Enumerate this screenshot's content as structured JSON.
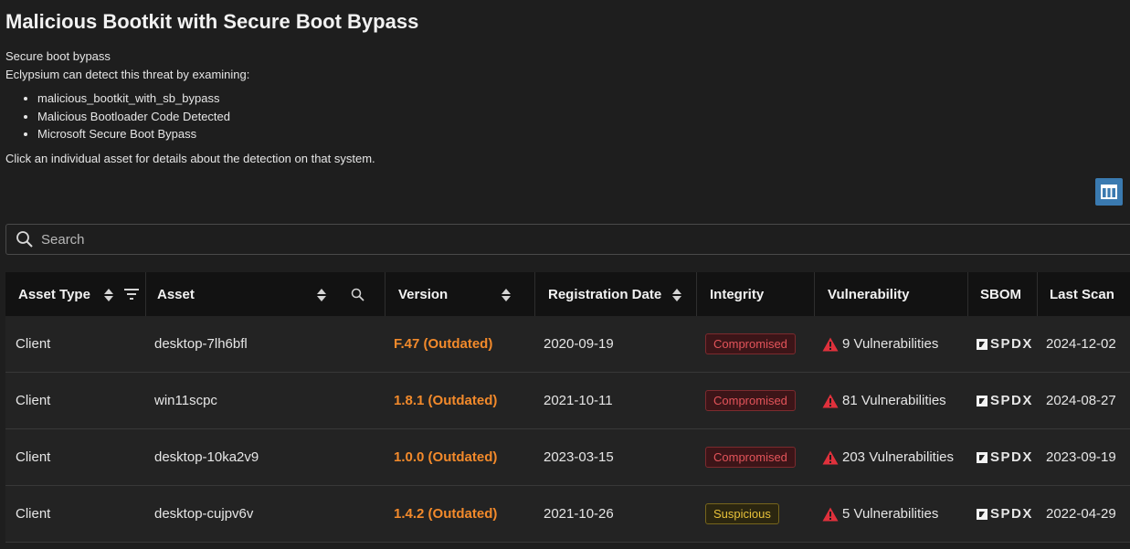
{
  "page": {
    "title": "Malicious Bootkit with Secure Boot Bypass",
    "subtitle": "Secure boot bypass",
    "intro": "Eclypsium can detect this threat by examining:",
    "bullets": [
      "malicious_bootkit_with_sb_bypass",
      "Malicious Bootloader Code Detected",
      "Microsoft Secure Boot Bypass"
    ],
    "hint": "Click an individual asset for details about the detection on that system."
  },
  "search": {
    "placeholder": "Search"
  },
  "table": {
    "columns": {
      "asset_type": "Asset Type",
      "asset": "Asset",
      "version": "Version",
      "registration_date": "Registration Date",
      "integrity": "Integrity",
      "vulnerability": "Vulnerability",
      "sbom": "SBOM",
      "last_scan": "Last Scan"
    },
    "sbom_label": "SPDX",
    "rows": [
      {
        "asset_type": "Client",
        "asset": "desktop-7lh6bfl",
        "version": "F.47 (Outdated)",
        "registration_date": "2020-09-19",
        "integrity": "Compromised",
        "vulnerability": "9 Vulnerabilities",
        "last_scan": "2024-12-02"
      },
      {
        "asset_type": "Client",
        "asset": "win11scpc",
        "version": "1.8.1 (Outdated)",
        "registration_date": "2021-10-11",
        "integrity": "Compromised",
        "vulnerability": "81 Vulnerabilities",
        "last_scan": "2024-08-27"
      },
      {
        "asset_type": "Client",
        "asset": "desktop-10ka2v9",
        "version": "1.0.0 (Outdated)",
        "registration_date": "2023-03-15",
        "integrity": "Compromised",
        "vulnerability": "203 Vulnerabilities",
        "last_scan": "2023-09-19"
      },
      {
        "asset_type": "Client",
        "asset": "desktop-cujpv6v",
        "version": "1.4.2 (Outdated)",
        "registration_date": "2021-10-26",
        "integrity": "Suspicious",
        "vulnerability": "5 Vulnerabilities",
        "last_scan": "2022-04-29"
      }
    ]
  },
  "colors": {
    "background": "#1e1e1e",
    "header_background": "#121212",
    "outdated_version": "#f38a2b",
    "compromised": "#e3545a",
    "suspicious": "#e8c23a",
    "warning_icon": "#e0313c",
    "column_button": "#3a7ab0"
  },
  "icons": [
    "columns-icon",
    "search-icon",
    "sort-icon",
    "filter-icon",
    "warning-icon",
    "spdx-logo-icon"
  ]
}
